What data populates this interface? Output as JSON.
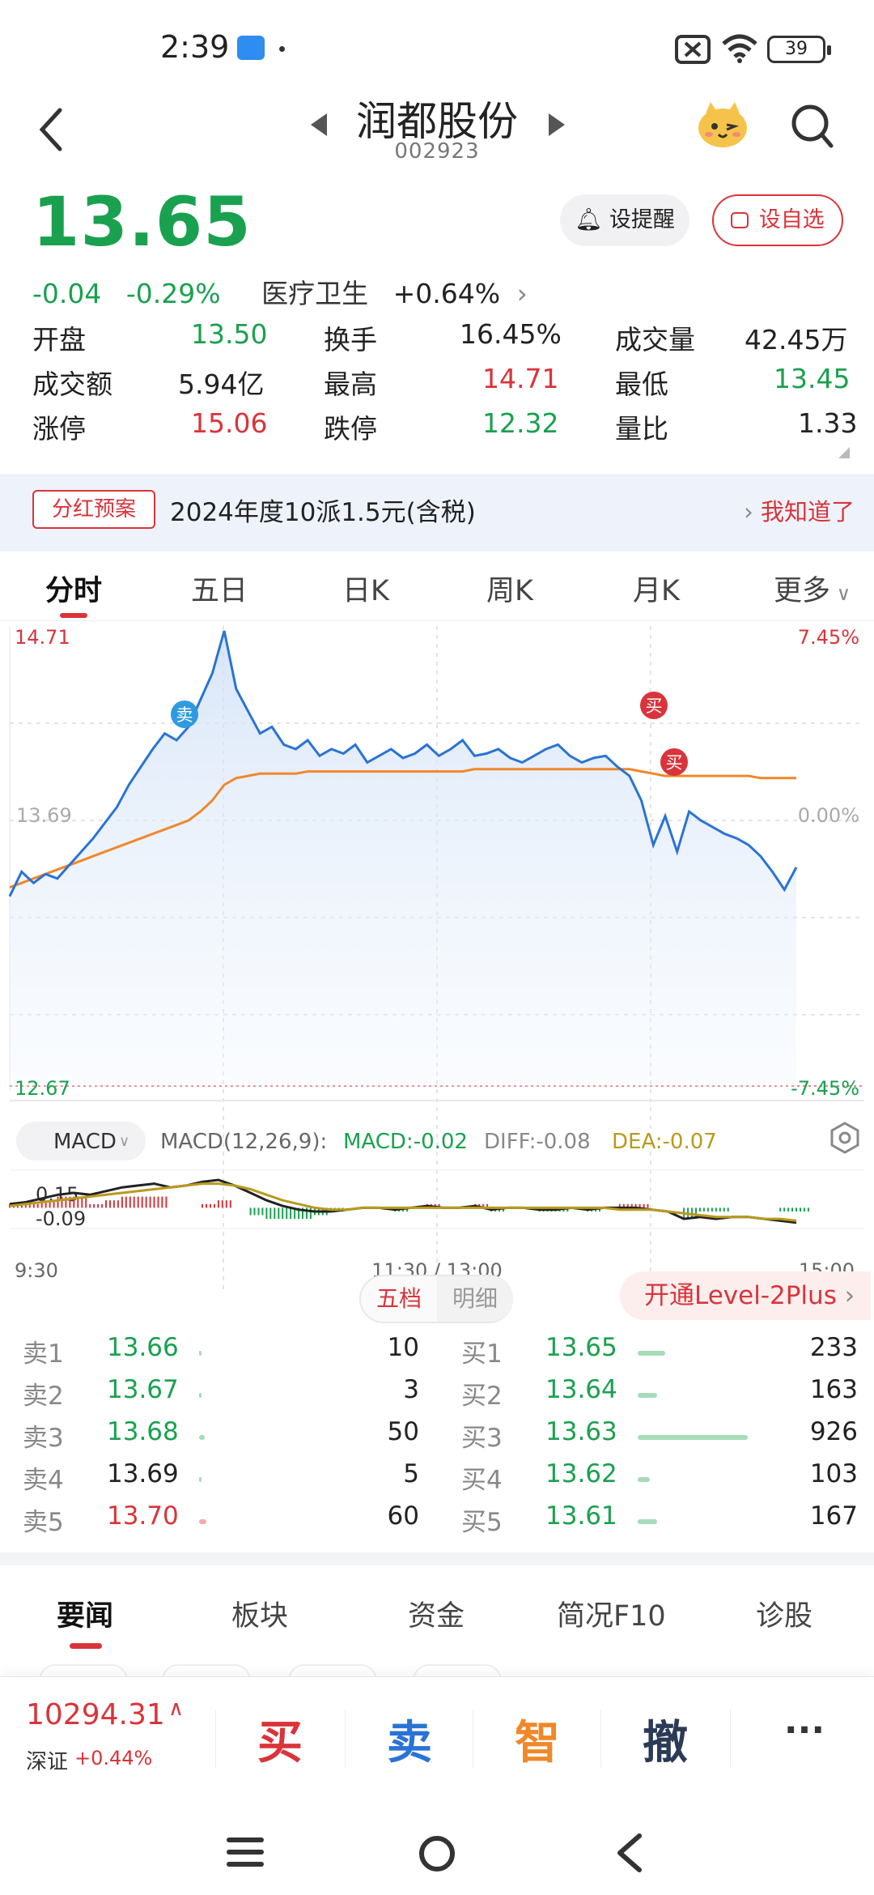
{
  "status_bar": {
    "time": "2:39",
    "battery": "39"
  },
  "header": {
    "stock_name": "润都股份",
    "stock_code": "002923"
  },
  "quote": {
    "price": "13.65",
    "change": "-0.04",
    "change_pct": "-0.29%",
    "sector": "医疗卫生",
    "sector_change": "+0.64%",
    "remind_label": "设提醒",
    "favorite_label": "设自选"
  },
  "stats": [
    [
      {
        "label": "开盘",
        "value": "13.50",
        "color": "green"
      },
      {
        "label": "换手",
        "value": "16.45%",
        "color": "dark"
      },
      {
        "label": "成交量",
        "value": "42.45万",
        "color": "dark"
      }
    ],
    [
      {
        "label": "成交额",
        "value": "5.94亿",
        "color": "dark"
      },
      {
        "label": "最高",
        "value": "14.71",
        "color": "red"
      },
      {
        "label": "最低",
        "value": "13.45",
        "color": "green"
      }
    ],
    [
      {
        "label": "涨停",
        "value": "15.06",
        "color": "red"
      },
      {
        "label": "跌停",
        "value": "12.32",
        "color": "green"
      },
      {
        "label": "量比",
        "value": "1.33",
        "color": "dark"
      }
    ]
  ],
  "dividend": {
    "tag": "分红预案",
    "text": "2024年度10派1.5元(含税)",
    "ack": "我知道了"
  },
  "chart_tabs": [
    "分时",
    "五日",
    "日K",
    "周K",
    "月K",
    "更多"
  ],
  "chart_data": [
    {
      "type": "line",
      "title": "",
      "x": [
        "9:30",
        "11:30 / 13:00",
        "15:00"
      ],
      "ylim": [
        12.67,
        14.71
      ],
      "y_left_ticks": [
        "14.71",
        "13.69",
        "12.67"
      ],
      "y_right_ticks": [
        "7.45%",
        "0.00%",
        "-7.45%"
      ],
      "series": [],
      "markers": [
        "卖",
        "买",
        "买"
      ],
      "price_series": [
        13.52,
        13.63,
        13.58,
        13.62,
        13.6,
        13.66,
        13.72,
        13.78,
        13.85,
        13.92,
        14.02,
        14.1,
        14.18,
        14.25,
        14.22,
        14.28,
        14.4,
        14.52,
        14.71,
        14.45,
        14.35,
        14.25,
        14.28,
        14.2,
        14.18,
        14.22,
        14.15,
        14.18,
        14.16,
        14.2,
        14.12,
        14.15,
        14.18,
        14.14,
        14.16,
        14.2,
        14.15,
        14.18,
        14.22,
        14.15,
        14.16,
        14.18,
        14.14,
        14.12,
        14.15,
        14.18,
        14.2,
        14.15,
        14.12,
        14.14,
        14.15,
        14.1,
        14.06,
        13.95,
        13.75,
        13.88,
        13.72,
        13.9,
        13.86,
        13.83,
        13.8,
        13.78,
        13.75,
        13.7,
        13.63,
        13.55,
        13.65
      ],
      "avg_series": [
        13.56,
        13.58,
        13.6,
        13.62,
        13.64,
        13.66,
        13.68,
        13.7,
        13.72,
        13.74,
        13.76,
        13.78,
        13.8,
        13.82,
        13.84,
        13.86,
        13.9,
        13.95,
        14.02,
        14.05,
        14.06,
        14.07,
        14.07,
        14.07,
        14.07,
        14.08,
        14.08,
        14.08,
        14.08,
        14.08,
        14.08,
        14.08,
        14.08,
        14.08,
        14.08,
        14.08,
        14.08,
        14.08,
        14.08,
        14.09,
        14.09,
        14.09,
        14.09,
        14.09,
        14.09,
        14.09,
        14.09,
        14.09,
        14.09,
        14.09,
        14.09,
        14.09,
        14.09,
        14.08,
        14.07,
        14.06,
        14.06,
        14.06,
        14.06,
        14.06,
        14.06,
        14.06,
        14.06,
        14.05,
        14.05,
        14.05,
        14.05
      ]
    },
    {
      "type": "line",
      "title": "MACD",
      "params": "MACD(12,26,9):",
      "macd_label": "MACD:-0.02",
      "diff_label": "DIFF:-0.08",
      "dea_label": "DEA:-0.07",
      "ylim": [
        -0.09,
        0.15
      ],
      "y_ticks": [
        "0.15",
        "-0.09"
      ],
      "series": [
        {
          "name": "DIFF",
          "values": [
            0.02,
            0.03,
            0.05,
            0.07,
            0.08,
            0.07,
            0.09,
            0.11,
            0.12,
            0.13,
            0.11,
            0.12,
            0.14,
            0.15,
            0.12,
            0.08,
            0.04,
            0.01,
            -0.01,
            -0.02,
            -0.02,
            -0.01,
            0.0,
            0.0,
            -0.01,
            0.0,
            0.01,
            0.0,
            0.0,
            0.01,
            -0.01,
            0.0,
            0.0,
            -0.01,
            -0.01,
            0.0,
            -0.01,
            0.0,
            0.0,
            0.0,
            -0.01,
            -0.02,
            -0.06,
            -0.05,
            -0.06,
            -0.05,
            -0.05,
            -0.06,
            -0.07,
            -0.08
          ]
        },
        {
          "name": "DEA",
          "values": [
            0.01,
            0.02,
            0.03,
            0.04,
            0.05,
            0.06,
            0.07,
            0.08,
            0.09,
            0.1,
            0.11,
            0.12,
            0.13,
            0.13,
            0.12,
            0.1,
            0.07,
            0.04,
            0.02,
            0.0,
            -0.01,
            -0.01,
            0.0,
            0.0,
            0.0,
            0.0,
            0.0,
            0.0,
            0.0,
            0.0,
            0.0,
            0.0,
            0.0,
            0.0,
            0.0,
            0.0,
            0.0,
            0.0,
            -0.01,
            -0.01,
            -0.01,
            -0.02,
            -0.03,
            -0.04,
            -0.05,
            -0.05,
            -0.05,
            -0.06,
            -0.06,
            -0.07
          ]
        }
      ],
      "x": [
        "9:30",
        "11:30 / 13:00",
        "15:00"
      ]
    }
  ],
  "order_book": {
    "toggle_five": "五档",
    "toggle_detail": "明细",
    "level2": "开通Level-2Plus",
    "asks": [
      {
        "label": "卖1",
        "price": "13.66",
        "vol": "10",
        "fill": 0.01,
        "color": "green"
      },
      {
        "label": "卖2",
        "price": "13.67",
        "vol": "3",
        "fill": 0.003,
        "color": "green"
      },
      {
        "label": "卖3",
        "price": "13.68",
        "vol": "50",
        "fill": 0.05,
        "color": "green"
      },
      {
        "label": "卖4",
        "price": "13.69",
        "vol": "5",
        "fill": 0.005,
        "color": "dark"
      },
      {
        "label": "卖5",
        "price": "13.70",
        "vol": "60",
        "fill": 0.065,
        "color": "red"
      }
    ],
    "bids": [
      {
        "label": "买1",
        "price": "13.65",
        "vol": "233",
        "fill": 0.25,
        "color": "green"
      },
      {
        "label": "买2",
        "price": "13.64",
        "vol": "163",
        "fill": 0.176,
        "color": "green"
      },
      {
        "label": "买3",
        "price": "13.63",
        "vol": "926",
        "fill": 1.0,
        "color": "green"
      },
      {
        "label": "买4",
        "price": "13.62",
        "vol": "103",
        "fill": 0.11,
        "color": "green"
      },
      {
        "label": "买5",
        "price": "13.61",
        "vol": "167",
        "fill": 0.18,
        "color": "green"
      }
    ]
  },
  "news_tabs": [
    "要闻",
    "板块",
    "资金",
    "简况F10",
    "诊股"
  ],
  "trade_bar": {
    "index_value": "10294.31",
    "index_name": "深证",
    "index_change": "+0.44%",
    "buy": "买",
    "sell": "卖",
    "smart": "智",
    "cancel": "撤",
    "more": "···"
  },
  "colors": {
    "red": "#d9343a",
    "green": "#1aa14f",
    "blue": "#2a73d6",
    "orange": "#f0882a"
  }
}
